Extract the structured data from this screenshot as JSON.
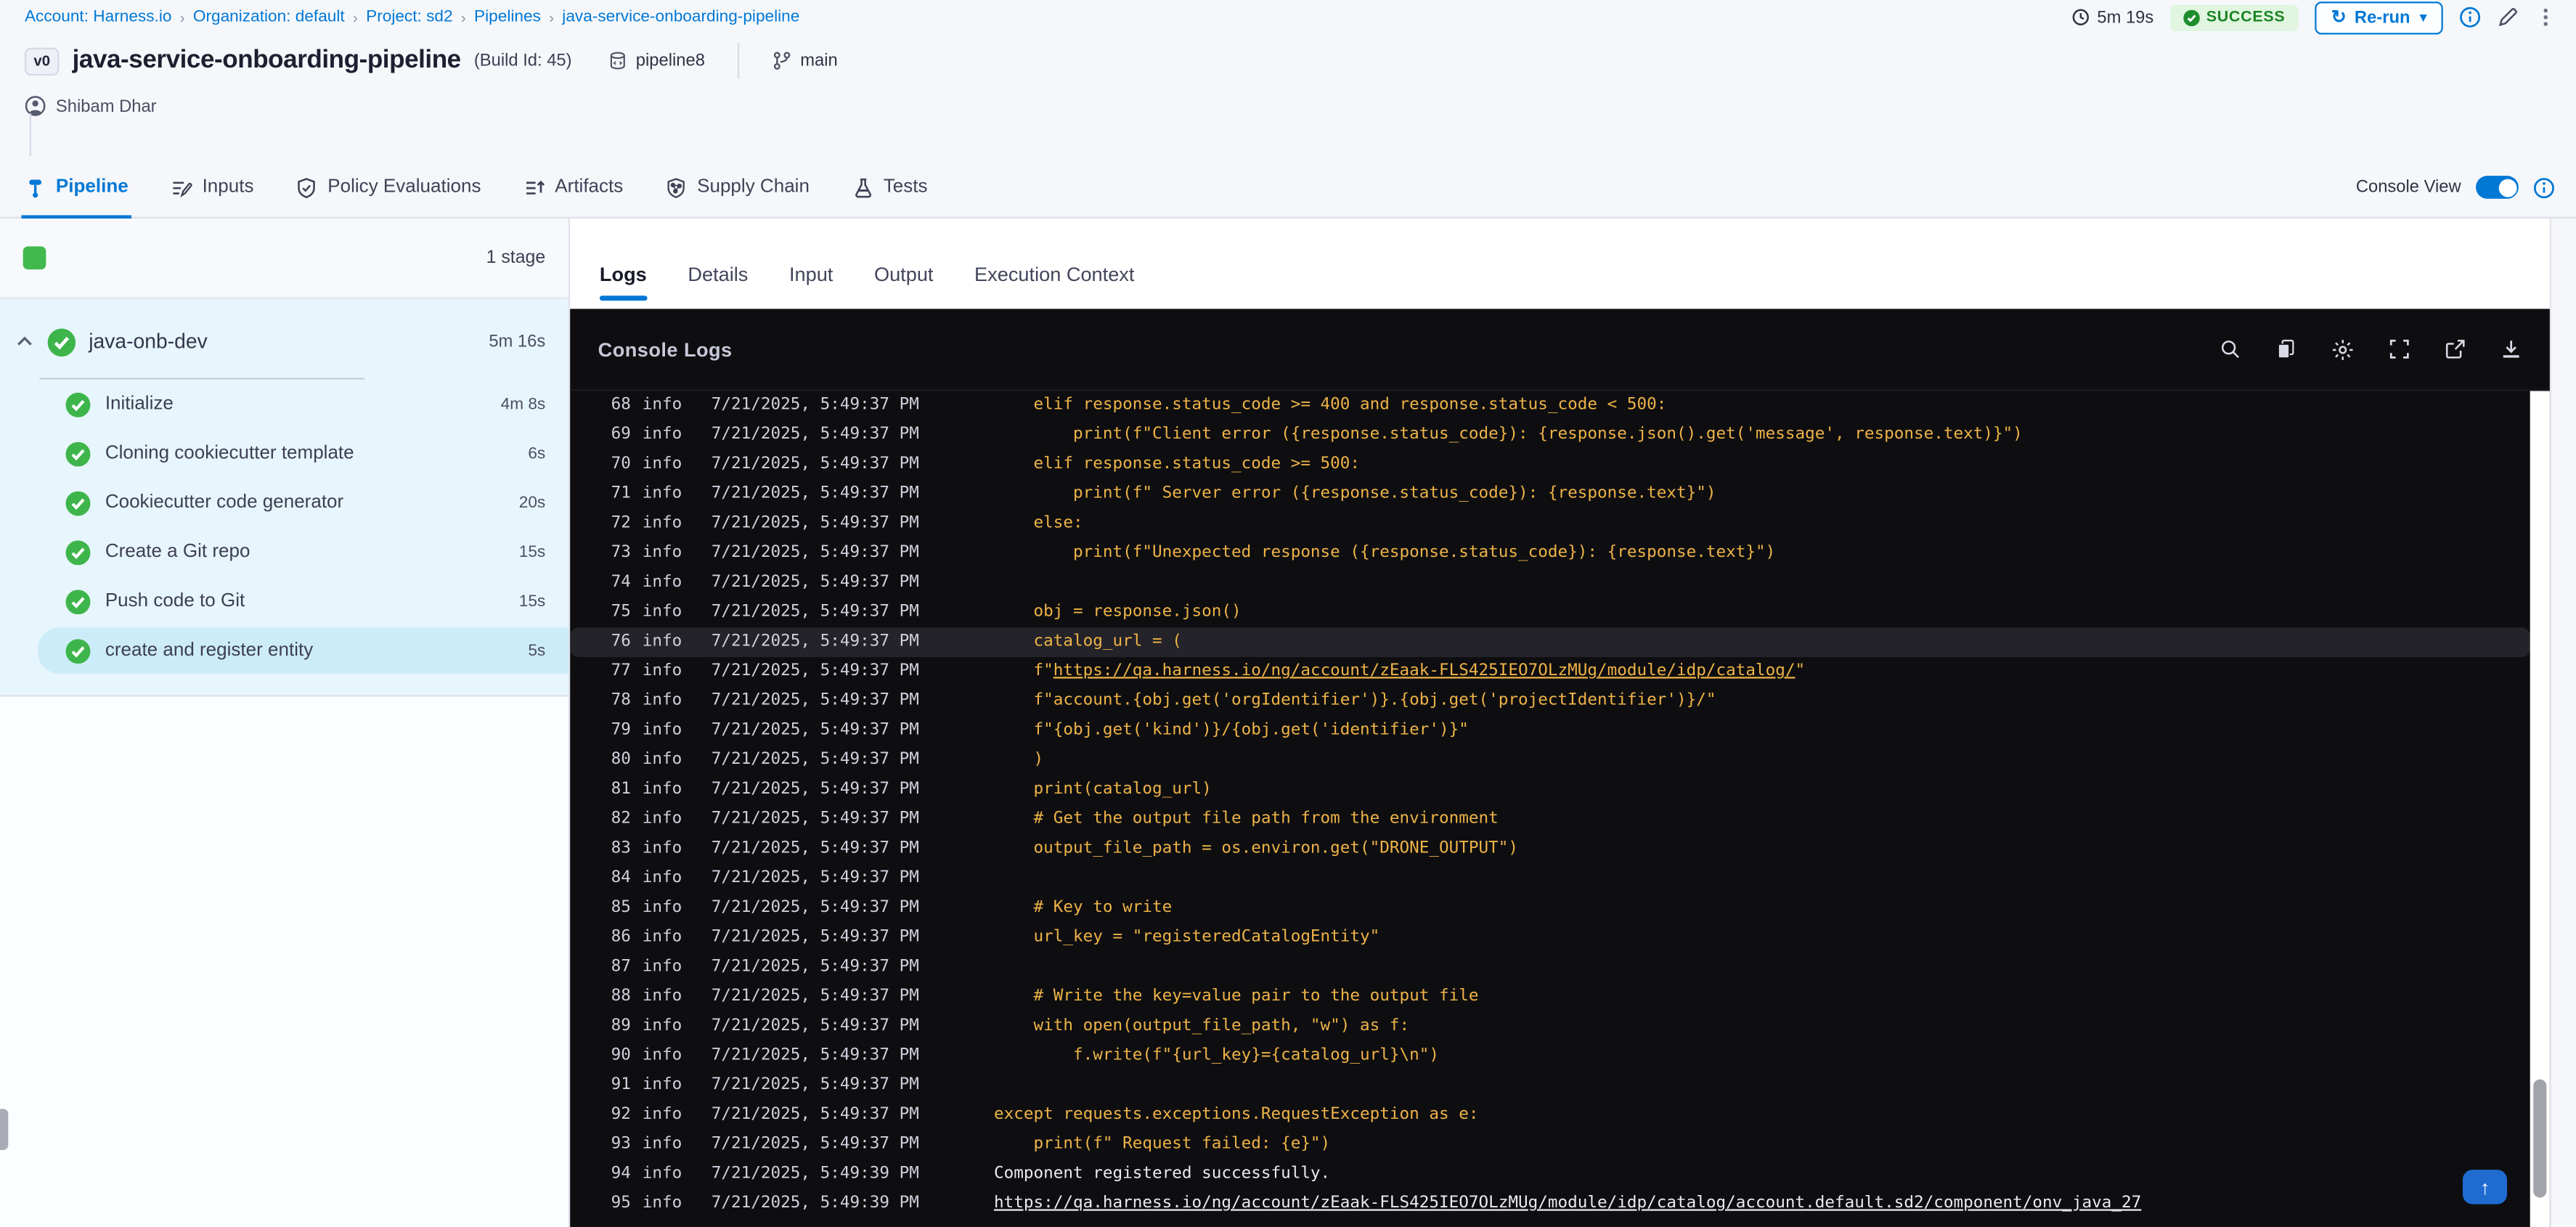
{
  "colors": {
    "accent": "#0278d5",
    "success_green": "#3eb54b",
    "console_yellow": "#eeb347",
    "console_bg": "#0e0e11",
    "highlight_row": "#232329",
    "stage_bg": "#e7f5fc",
    "selected_step_bg": "#cdecf9"
  },
  "breadcrumb": {
    "separator": "›",
    "items": [
      "Account: Harness.io",
      "Organization: default",
      "Project: sd2",
      "Pipelines",
      "java-service-onboarding-pipeline"
    ]
  },
  "run_meta": {
    "duration": "5m 19s",
    "status": "SUCCESS",
    "rerun": "Re-run"
  },
  "pipeline_header": {
    "version": "v0",
    "title": "java-service-onboarding-pipeline",
    "build": "(Build Id: 45)",
    "repo": "pipeline8",
    "branch": "main",
    "author": "Shibam Dhar"
  },
  "nav_tabs": {
    "console_view": "Console View",
    "console_view_on": true,
    "items": [
      {
        "label": "Pipeline",
        "icon": "pipeline-icon",
        "active": true
      },
      {
        "label": "Inputs",
        "icon": "inputs-icon",
        "active": false
      },
      {
        "label": "Policy Evaluations",
        "icon": "policy-icon",
        "active": false
      },
      {
        "label": "Artifacts",
        "icon": "artifacts-icon",
        "active": false
      },
      {
        "label": "Supply Chain",
        "icon": "supply-chain-icon",
        "active": false
      },
      {
        "label": "Tests",
        "icon": "tests-icon",
        "active": false
      }
    ]
  },
  "sidebar": {
    "stage_count": "1 stage",
    "stage": {
      "name": "java-onb-dev",
      "duration": "5m 16s"
    },
    "steps": [
      {
        "label": "Initialize",
        "duration": "4m 8s",
        "selected": false
      },
      {
        "label": "Cloning cookiecutter template",
        "duration": "6s",
        "selected": false
      },
      {
        "label": "Cookiecutter code generator",
        "duration": "20s",
        "selected": false
      },
      {
        "label": "Create a Git repo",
        "duration": "15s",
        "selected": false
      },
      {
        "label": "Push code to Git",
        "duration": "15s",
        "selected": false
      },
      {
        "label": "create and register entity",
        "duration": "5s",
        "selected": true
      }
    ]
  },
  "log_panel": {
    "tabs": [
      "Logs",
      "Details",
      "Input",
      "Output",
      "Execution Context"
    ],
    "active_tab": "Logs",
    "title": "Console Logs",
    "toolbar_icons": [
      "search-icon",
      "copy-icon",
      "settings-icon",
      "fullscreen-icon",
      "open-new-icon",
      "download-icon"
    ]
  },
  "logs": [
    {
      "n": "68",
      "level": "info",
      "ts": "7/21/2025, 5:49:37 PM",
      "style": "code",
      "highlight": false,
      "parts": [
        {
          "s": "    elif response.status_code >= 400 and response.status_code < 500:"
        }
      ]
    },
    {
      "n": "69",
      "level": "info",
      "ts": "7/21/2025, 5:49:37 PM",
      "style": "code",
      "highlight": false,
      "parts": [
        {
          "s": "        print(f\"Client error ({response.status_code}): {response.json().get('message', response.text)}\")"
        }
      ]
    },
    {
      "n": "70",
      "level": "info",
      "ts": "7/21/2025, 5:49:37 PM",
      "style": "code",
      "highlight": false,
      "parts": [
        {
          "s": "    elif response.status_code >= 500:"
        }
      ]
    },
    {
      "n": "71",
      "level": "info",
      "ts": "7/21/2025, 5:49:37 PM",
      "style": "code",
      "highlight": false,
      "parts": [
        {
          "s": "        print(f\" Server error ({response.status_code}): {response.text}\")"
        }
      ]
    },
    {
      "n": "72",
      "level": "info",
      "ts": "7/21/2025, 5:49:37 PM",
      "style": "code",
      "highlight": false,
      "parts": [
        {
          "s": "    else:"
        }
      ]
    },
    {
      "n": "73",
      "level": "info",
      "ts": "7/21/2025, 5:49:37 PM",
      "style": "code",
      "highlight": false,
      "parts": [
        {
          "s": "        print(f\"Unexpected response ({response.status_code}): {response.text}\")"
        }
      ]
    },
    {
      "n": "74",
      "level": "info",
      "ts": "7/21/2025, 5:49:37 PM",
      "style": "code",
      "highlight": false,
      "parts": [
        {
          "s": ""
        }
      ]
    },
    {
      "n": "75",
      "level": "info",
      "ts": "7/21/2025, 5:49:37 PM",
      "style": "code",
      "highlight": false,
      "parts": [
        {
          "s": "    obj = response.json()"
        }
      ]
    },
    {
      "n": "76",
      "level": "info",
      "ts": "7/21/2025, 5:49:37 PM",
      "style": "code",
      "highlight": true,
      "parts": [
        {
          "s": "    catalog_url = ("
        }
      ]
    },
    {
      "n": "77",
      "level": "info",
      "ts": "7/21/2025, 5:49:37 PM",
      "style": "code",
      "highlight": false,
      "parts": [
        {
          "s": "    f\""
        },
        {
          "s": "https://qa.harness.io/ng/account/zEaak-FLS425IEO7OLzMUg/module/idp/catalog/",
          "link": true
        },
        {
          "s": "\""
        }
      ]
    },
    {
      "n": "78",
      "level": "info",
      "ts": "7/21/2025, 5:49:37 PM",
      "style": "code",
      "highlight": false,
      "parts": [
        {
          "s": "    f\"account.{obj.get('orgIdentifier')}.{obj.get('projectIdentifier')}/\""
        }
      ]
    },
    {
      "n": "79",
      "level": "info",
      "ts": "7/21/2025, 5:49:37 PM",
      "style": "code",
      "highlight": false,
      "parts": [
        {
          "s": "    f\"{obj.get('kind')}/{obj.get('identifier')}\""
        }
      ]
    },
    {
      "n": "80",
      "level": "info",
      "ts": "7/21/2025, 5:49:37 PM",
      "style": "code",
      "highlight": false,
      "parts": [
        {
          "s": "    )"
        }
      ]
    },
    {
      "n": "81",
      "level": "info",
      "ts": "7/21/2025, 5:49:37 PM",
      "style": "code",
      "highlight": false,
      "parts": [
        {
          "s": "    print(catalog_url)"
        }
      ]
    },
    {
      "n": "82",
      "level": "info",
      "ts": "7/21/2025, 5:49:37 PM",
      "style": "code",
      "highlight": false,
      "parts": [
        {
          "s": "    # Get the output file path from the environment"
        }
      ]
    },
    {
      "n": "83",
      "level": "info",
      "ts": "7/21/2025, 5:49:37 PM",
      "style": "code",
      "highlight": false,
      "parts": [
        {
          "s": "    output_file_path = os.environ.get(\"DRONE_OUTPUT\")"
        }
      ]
    },
    {
      "n": "84",
      "level": "info",
      "ts": "7/21/2025, 5:49:37 PM",
      "style": "code",
      "highlight": false,
      "parts": [
        {
          "s": ""
        }
      ]
    },
    {
      "n": "85",
      "level": "info",
      "ts": "7/21/2025, 5:49:37 PM",
      "style": "code",
      "highlight": false,
      "parts": [
        {
          "s": "    # Key to write"
        }
      ]
    },
    {
      "n": "86",
      "level": "info",
      "ts": "7/21/2025, 5:49:37 PM",
      "style": "code",
      "highlight": false,
      "parts": [
        {
          "s": "    url_key = \"registeredCatalogEntity\""
        }
      ]
    },
    {
      "n": "87",
      "level": "info",
      "ts": "7/21/2025, 5:49:37 PM",
      "style": "code",
      "highlight": false,
      "parts": [
        {
          "s": ""
        }
      ]
    },
    {
      "n": "88",
      "level": "info",
      "ts": "7/21/2025, 5:49:37 PM",
      "style": "code",
      "highlight": false,
      "parts": [
        {
          "s": "    # Write the key=value pair to the output file"
        }
      ]
    },
    {
      "n": "89",
      "level": "info",
      "ts": "7/21/2025, 5:49:37 PM",
      "style": "code",
      "highlight": false,
      "parts": [
        {
          "s": "    with open(output_file_path, \"w\") as f:"
        }
      ]
    },
    {
      "n": "90",
      "level": "info",
      "ts": "7/21/2025, 5:49:37 PM",
      "style": "code",
      "highlight": false,
      "parts": [
        {
          "s": "        f.write(f\"{url_key}={catalog_url}\\n\")"
        }
      ]
    },
    {
      "n": "91",
      "level": "info",
      "ts": "7/21/2025, 5:49:37 PM",
      "style": "code",
      "highlight": false,
      "parts": [
        {
          "s": ""
        }
      ]
    },
    {
      "n": "92",
      "level": "info",
      "ts": "7/21/2025, 5:49:37 PM",
      "style": "code",
      "highlight": false,
      "parts": [
        {
          "s": "except requests.exceptions.RequestException as e:"
        }
      ]
    },
    {
      "n": "93",
      "level": "info",
      "ts": "7/21/2025, 5:49:37 PM",
      "style": "code",
      "highlight": false,
      "parts": [
        {
          "s": "    print(f\" Request failed: {e}\")"
        }
      ]
    },
    {
      "n": "94",
      "level": "info",
      "ts": "7/21/2025, 5:49:39 PM",
      "style": "plain",
      "highlight": false,
      "parts": [
        {
          "s": "Component registered successfully."
        }
      ]
    },
    {
      "n": "95",
      "level": "info",
      "ts": "7/21/2025, 5:49:39 PM",
      "style": "plain",
      "highlight": false,
      "parts": [
        {
          "s": "https://qa.harness.io/ng/account/zEaak-FLS425IEO7OLzMUg/module/idp/catalog/account.default.sd2/component/onv_java_27",
          "link": true
        }
      ]
    }
  ]
}
